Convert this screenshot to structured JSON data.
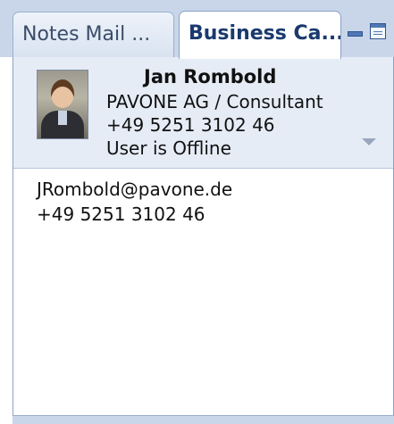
{
  "tabs": [
    {
      "label": "Notes Mail ...",
      "active": false
    },
    {
      "label": "Business Ca...",
      "active": true
    }
  ],
  "window_controls": {
    "minimize_icon": "minimize-icon",
    "maximize_icon": "maximize-icon"
  },
  "contact": {
    "name": "Jan Rombold",
    "company": "PAVONE AG / Consultant",
    "phone": "+49 5251 3102 46",
    "status": "User is Offline",
    "email": "JRombold@pavone.de",
    "phone_detail": "+49 5251 3102 46",
    "avatar": "person-photo"
  },
  "colors": {
    "tabstrip": "#c9d6ea",
    "header_card": "#e6ecf6",
    "accent": "#4f78b4"
  }
}
